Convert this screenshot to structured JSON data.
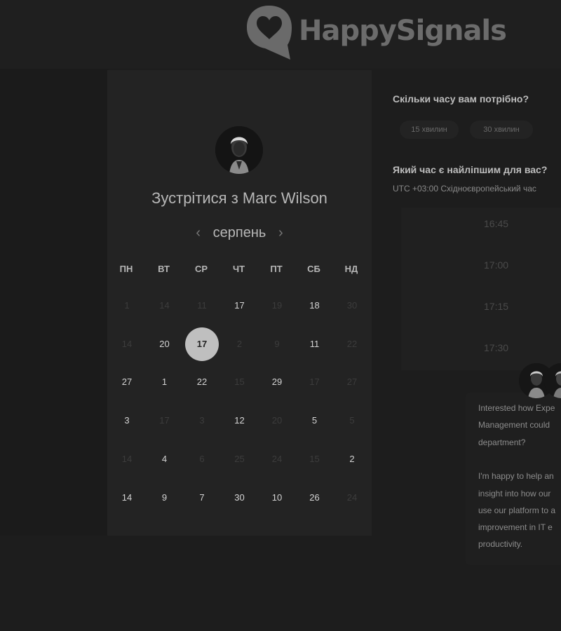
{
  "brand": {
    "name": "HappySignals"
  },
  "meeting": {
    "title": "Зустрітися з Marc Wilson",
    "month": "серпень",
    "prev": "‹",
    "next": "›"
  },
  "weekdays": [
    "ПН",
    "ВТ",
    "СР",
    "ЧТ",
    "ПТ",
    "СБ",
    "НД"
  ],
  "calendar": {
    "rows": [
      [
        {
          "d": "1",
          "on": false
        },
        {
          "d": "14",
          "on": false
        },
        {
          "d": "11",
          "on": false
        },
        {
          "d": "17",
          "on": true
        },
        {
          "d": "19",
          "on": false
        },
        {
          "d": "18",
          "on": true
        },
        {
          "d": "30",
          "on": false
        }
      ],
      [
        {
          "d": "14",
          "on": false
        },
        {
          "d": "20",
          "on": true
        },
        {
          "d": "17",
          "on": true,
          "selected": true
        },
        {
          "d": "2",
          "on": false
        },
        {
          "d": "9",
          "on": false
        },
        {
          "d": "11",
          "on": true
        },
        {
          "d": "22",
          "on": false
        }
      ],
      [
        {
          "d": "27",
          "on": true
        },
        {
          "d": "1",
          "on": true
        },
        {
          "d": "22",
          "on": true
        },
        {
          "d": "15",
          "on": false
        },
        {
          "d": "29",
          "on": true
        },
        {
          "d": "17",
          "on": false
        },
        {
          "d": "27",
          "on": false
        }
      ],
      [
        {
          "d": "3",
          "on": true
        },
        {
          "d": "17",
          "on": false
        },
        {
          "d": "3",
          "on": false
        },
        {
          "d": "12",
          "on": true
        },
        {
          "d": "20",
          "on": false
        },
        {
          "d": "5",
          "on": true
        },
        {
          "d": "5",
          "on": false
        }
      ],
      [
        {
          "d": "14",
          "on": false
        },
        {
          "d": "4",
          "on": true
        },
        {
          "d": "6",
          "on": false
        },
        {
          "d": "25",
          "on": false
        },
        {
          "d": "24",
          "on": false
        },
        {
          "d": "15",
          "on": false
        },
        {
          "d": "2",
          "on": true
        }
      ],
      [
        {
          "d": "14",
          "on": true
        },
        {
          "d": "9",
          "on": true
        },
        {
          "d": "7",
          "on": true
        },
        {
          "d": "30",
          "on": true
        },
        {
          "d": "10",
          "on": true
        },
        {
          "d": "26",
          "on": true
        },
        {
          "d": "24",
          "on": false
        }
      ]
    ]
  },
  "duration": {
    "question": "Скільки часу вам потрібно?",
    "options": [
      "15 хвилин",
      "30 хвилин"
    ]
  },
  "time": {
    "question": "Який час є найліпшим для вас?",
    "timezone": "UTC +03:00 Східноєвропейський час",
    "slots": [
      "16:45",
      "17:00",
      "17:15",
      "17:30"
    ]
  },
  "blurb": {
    "lines": [
      "Interested how Expe",
      "Management could",
      "department?",
      "",
      "I'm happy to help an",
      "insight into how our",
      "use our platform to a",
      "improvement in IT e",
      "productivity."
    ]
  },
  "colors": {
    "selected_day_bg": "#bfbfbf",
    "page_bg": "#1d1d1d"
  }
}
